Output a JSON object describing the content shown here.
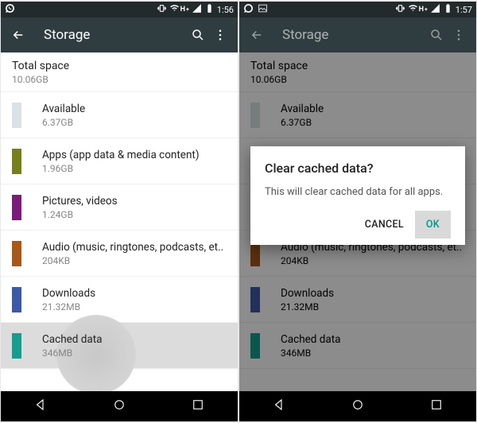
{
  "status": {
    "time_left": "1:56",
    "time_right": "1:57",
    "h": "H",
    "plus": "+"
  },
  "toolbar": {
    "title": "Storage"
  },
  "header": {
    "label": "Total space",
    "value": "10.06GB"
  },
  "rows": [
    {
      "label": "Available",
      "value": "6.37GB",
      "color": "#d9e2e4"
    },
    {
      "label": "Apps (app data & media content)",
      "value": "1.96GB",
      "color": "#76801a"
    },
    {
      "label": "Pictures, videos",
      "value": "1.24GB",
      "color": "#7c1a7a"
    },
    {
      "label": "Audio (music, ringtones, podcasts, et..",
      "value": "204KB",
      "color": "#a85818"
    },
    {
      "label": "Downloads",
      "value": "21.32MB",
      "color": "#3c59a8"
    },
    {
      "label": "Cached data",
      "value": "346MB",
      "color": "#159e8f"
    }
  ],
  "dialog": {
    "title": "Clear cached data?",
    "message": "This will clear cached data for all apps.",
    "cancel": "CANCEL",
    "ok": "OK"
  }
}
